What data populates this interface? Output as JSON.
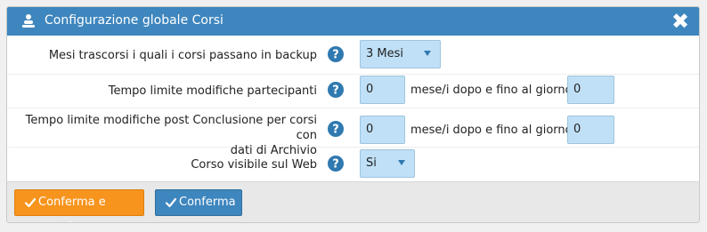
{
  "dialog": {
    "title": "Configurazione globale Corsi",
    "close_icon": "close-icon",
    "title_icon": "settings-people-icon"
  },
  "fields": {
    "backup": {
      "label": "Mesi trascorsi i quali i corsi passano in backup",
      "value": "3 Mesi"
    },
    "participants_limit": {
      "label": "Tempo limite modifiche partecipanti",
      "months_value": "0",
      "middle_text": "mese/i dopo e fino al giorno",
      "day_value": "0"
    },
    "archive_limit": {
      "label_line1": "Tempo limite modifiche post Conclusione per corsi con",
      "label_line2": "dati di Archivio",
      "months_value": "0",
      "middle_text": "mese/i dopo e fino al giorno",
      "day_value": "0"
    },
    "web_visible": {
      "label": "Corso visibile sul Web",
      "value": "Si"
    }
  },
  "footer": {
    "confirm_close_label": "Conferma e chiudi",
    "confirm_label": "Conferma"
  },
  "colors": {
    "titlebar": "#3e86be",
    "field_bg": "#bfe0f6",
    "help_icon": "#2f79b0",
    "btn_orange": "#f7941d",
    "btn_blue": "#3e86be"
  }
}
